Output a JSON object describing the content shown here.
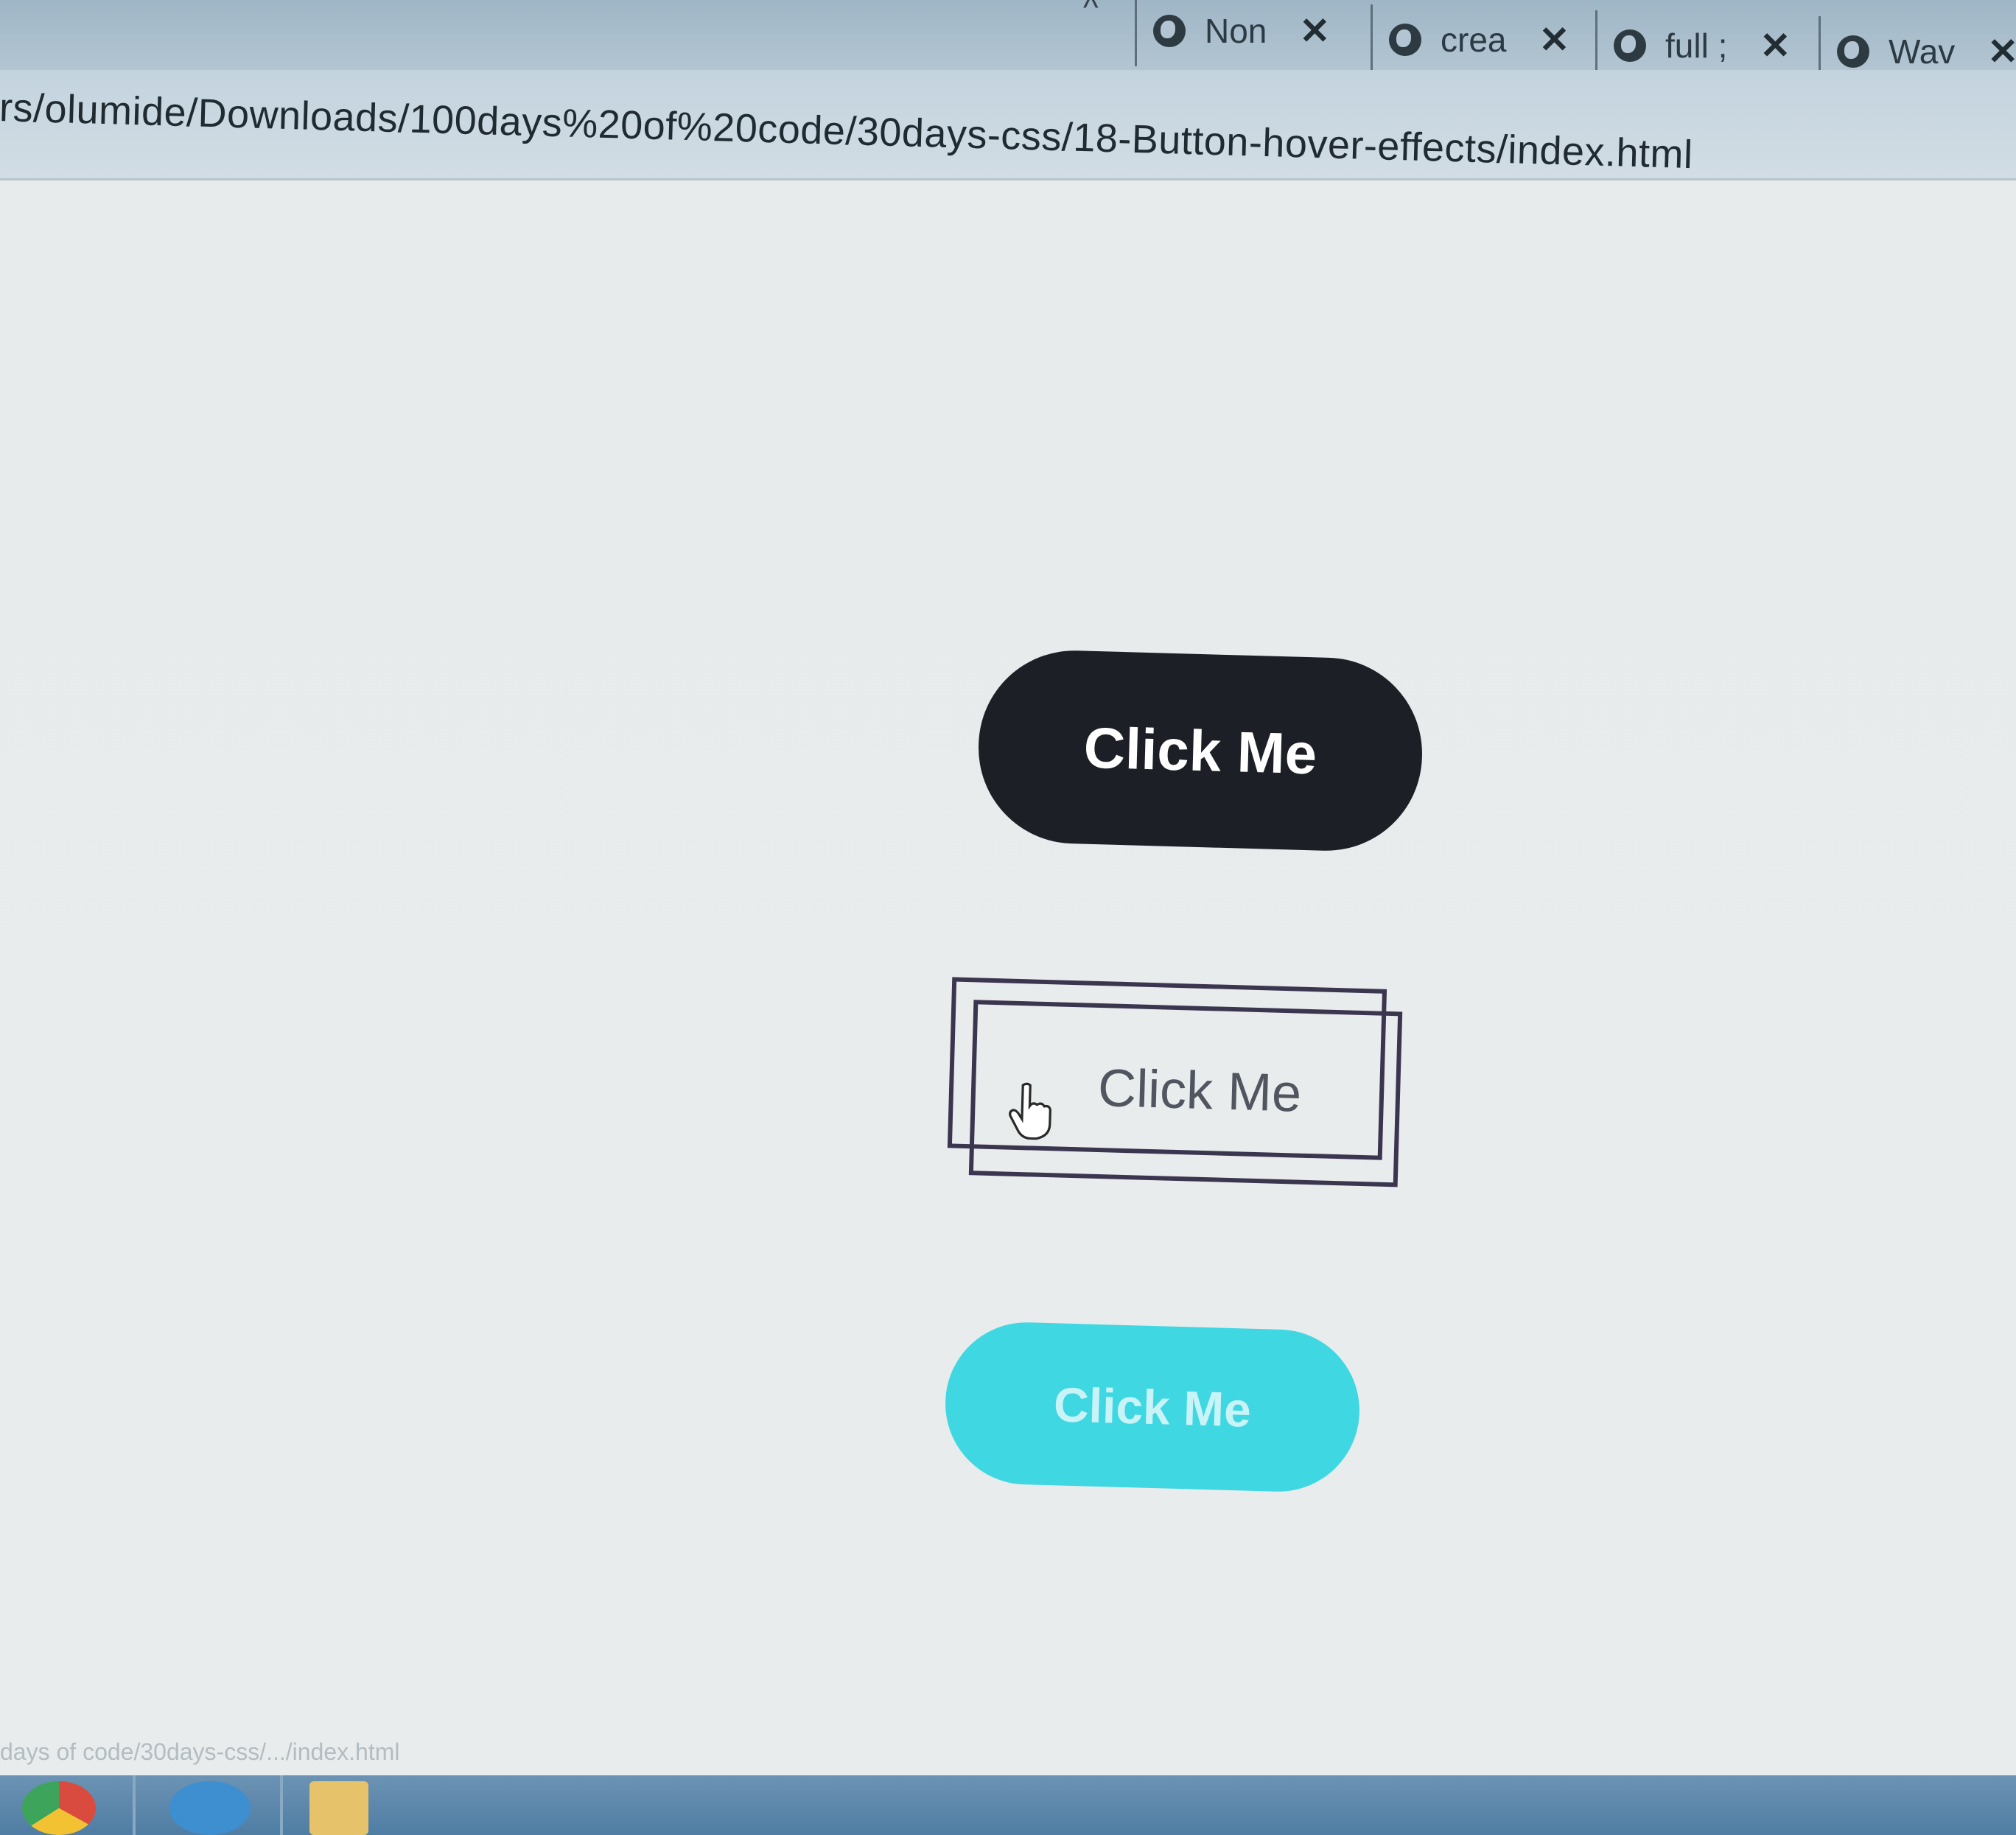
{
  "browser": {
    "tabs": [
      {
        "label": "Non",
        "close": "✕"
      },
      {
        "label": "crea",
        "close": "✕"
      },
      {
        "label": "full ;",
        "close": "✕"
      },
      {
        "label": "Wav",
        "close": "✕"
      }
    ],
    "tab_overflow_arrow": "^",
    "url": "rs/olumide/Downloads/100days%20of%20code/30days-css/18-Button-hover-effects/index.html"
  },
  "page": {
    "buttons": [
      {
        "label": "Click Me",
        "style": "dark-pill",
        "color": "#1d1f26"
      },
      {
        "label": "Click Me",
        "style": "double-outline",
        "color": "#3b3550"
      },
      {
        "label": "Click Me",
        "style": "cyan-pill",
        "color": "#3ed7e2"
      }
    ],
    "cursor": "hand-pointer-icon"
  },
  "status_bar": {
    "text": "days of code/30days-css/.../index.html"
  },
  "taskbar": {
    "items": [
      "chrome-icon",
      "ie-icon",
      "folder-icon"
    ]
  }
}
